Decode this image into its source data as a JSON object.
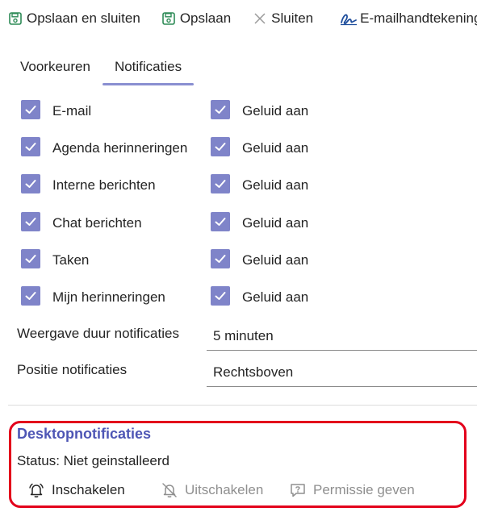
{
  "toolbar": {
    "save_close_label": "Opslaan en sluiten",
    "save_label": "Opslaan",
    "close_label": "Sluiten",
    "signature_label": "E-mailhandtekening"
  },
  "tabs": [
    {
      "label": "Voorkeuren",
      "active": false
    },
    {
      "label": "Notificaties",
      "active": true
    }
  ],
  "notifications": [
    {
      "label": "E-mail",
      "checked": true,
      "sound_label": "Geluid aan",
      "sound_checked": true
    },
    {
      "label": "Agenda herinneringen",
      "checked": true,
      "sound_label": "Geluid aan",
      "sound_checked": true
    },
    {
      "label": "Interne berichten",
      "checked": true,
      "sound_label": "Geluid aan",
      "sound_checked": true
    },
    {
      "label": "Chat berichten",
      "checked": true,
      "sound_label": "Geluid aan",
      "sound_checked": true
    },
    {
      "label": "Taken",
      "checked": true,
      "sound_label": "Geluid aan",
      "sound_checked": true
    },
    {
      "label": "Mijn herinneringen",
      "checked": true,
      "sound_label": "Geluid aan",
      "sound_checked": true
    }
  ],
  "duration": {
    "label": "Weergave duur notificaties",
    "value": "5 minuten"
  },
  "position": {
    "label": "Positie notificaties",
    "value": "Rechtsboven"
  },
  "desktop": {
    "title": "Desktopnotificaties",
    "status": "Status: Niet geinstalleerd",
    "enable_label": "Inschakelen",
    "disable_label": "Uitschakelen",
    "permission_label": "Permissie geven"
  },
  "colors": {
    "checkbox": "#7f84c9",
    "tab_indicator": "#8a8fd1",
    "save_icon": "#2e8b57",
    "signature_icon": "#1f4e9c",
    "desktop_title": "#4e56b5",
    "highlight_border": "#e3001b",
    "disabled_text": "#8f8f8f"
  }
}
